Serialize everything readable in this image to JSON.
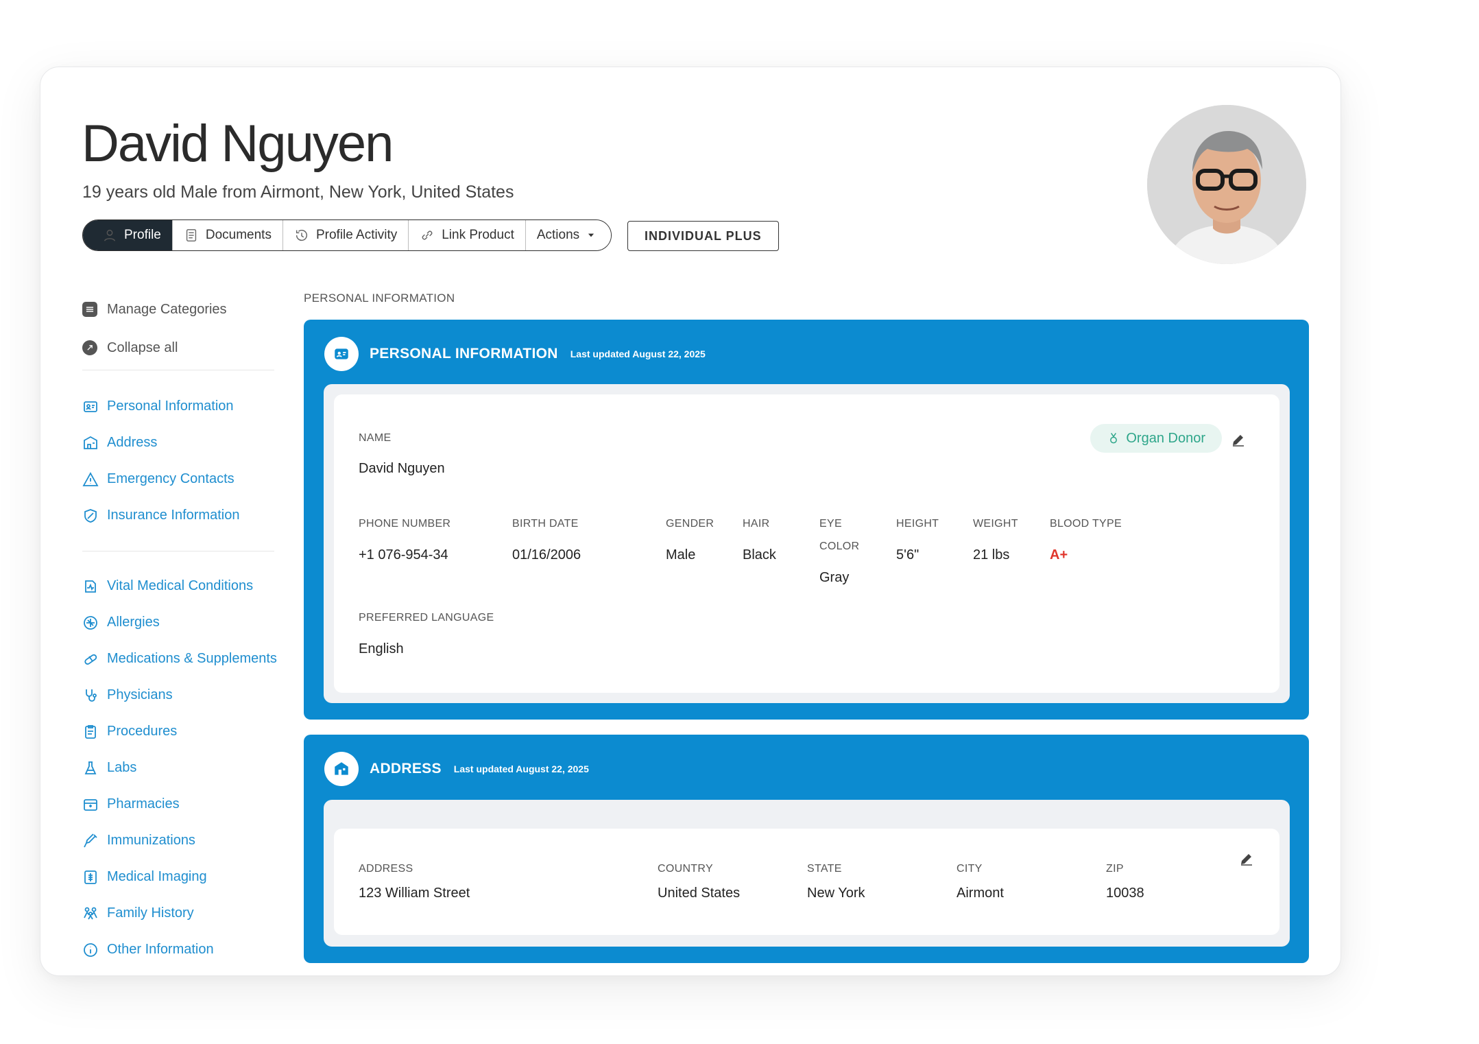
{
  "header": {
    "name": "David Nguyen",
    "subtitle": "19 years old Male from Airmont, New York, United States",
    "plan": "INDIVIDUAL PLUS"
  },
  "tabs": [
    {
      "label": "Profile",
      "icon": "user-icon"
    },
    {
      "label": "Documents",
      "icon": "document-icon"
    },
    {
      "label": "Profile Activity",
      "icon": "history-icon"
    },
    {
      "label": "Link Product",
      "icon": "link-icon"
    },
    {
      "label": "Actions",
      "icon": "caret-down-icon"
    }
  ],
  "sidebar": {
    "tools": [
      {
        "label": "Manage Categories",
        "icon": "categories-icon"
      },
      {
        "label": "Collapse all",
        "icon": "collapse-icon"
      }
    ],
    "group1": [
      {
        "label": "Personal Information",
        "icon": "id-card-icon"
      },
      {
        "label": "Address",
        "icon": "house-icon"
      },
      {
        "label": "Emergency Contacts",
        "icon": "warning-icon"
      },
      {
        "label": "Insurance Information",
        "icon": "shield-icon"
      }
    ],
    "group2": [
      {
        "label": "Vital Medical Conditions",
        "icon": "heart-monitor-icon"
      },
      {
        "label": "Allergies",
        "icon": "allergy-icon"
      },
      {
        "label": "Medications & Supplements",
        "icon": "pill-icon"
      },
      {
        "label": "Physicians",
        "icon": "stethoscope-icon"
      },
      {
        "label": "Procedures",
        "icon": "clipboard-icon"
      },
      {
        "label": "Labs",
        "icon": "flask-icon"
      },
      {
        "label": "Pharmacies",
        "icon": "store-icon"
      },
      {
        "label": "Immunizations",
        "icon": "syringe-icon"
      },
      {
        "label": "Medical Imaging",
        "icon": "xray-icon"
      },
      {
        "label": "Family History",
        "icon": "family-icon"
      },
      {
        "label": "Other Information",
        "icon": "info-icon"
      }
    ]
  },
  "main": {
    "crumb": "PERSONAL INFORMATION",
    "personal": {
      "title": "PERSONAL INFORMATION",
      "updated": "Last updated August 22, 2025",
      "organ_donor": "Organ Donor",
      "name_label": "NAME",
      "name_value": "David Nguyen",
      "fields": [
        {
          "label": "PHONE NUMBER",
          "value": "+1 076-954-34"
        },
        {
          "label": "BIRTH DATE",
          "value": "01/16/2006"
        },
        {
          "label": "GENDER",
          "value": "Male"
        },
        {
          "label": "HAIR",
          "value": "Black"
        },
        {
          "label": "EYE",
          "label2": "COLOR",
          "value": "Gray"
        },
        {
          "label": "HEIGHT",
          "value": "5'6\""
        },
        {
          "label": "WEIGHT",
          "value": "21 lbs"
        },
        {
          "label": "BLOOD TYPE",
          "value": "A+"
        }
      ],
      "lang_label": "PREFERRED LANGUAGE",
      "lang_value": "English"
    },
    "address": {
      "title": "ADDRESS",
      "updated": "Last updated August 22, 2025",
      "fields": [
        {
          "label": "ADDRESS",
          "value": "123 William Street"
        },
        {
          "label": "COUNTRY",
          "value": "United States"
        },
        {
          "label": "STATE",
          "value": "New York"
        },
        {
          "label": "CITY",
          "value": "Airmont"
        },
        {
          "label": "ZIP",
          "value": "10038"
        }
      ]
    }
  },
  "colors": {
    "accent": "#0c8bd0",
    "link": "#1f8ecf",
    "organ_donor": "#2ea68a",
    "blood_type": "#e0362c"
  }
}
